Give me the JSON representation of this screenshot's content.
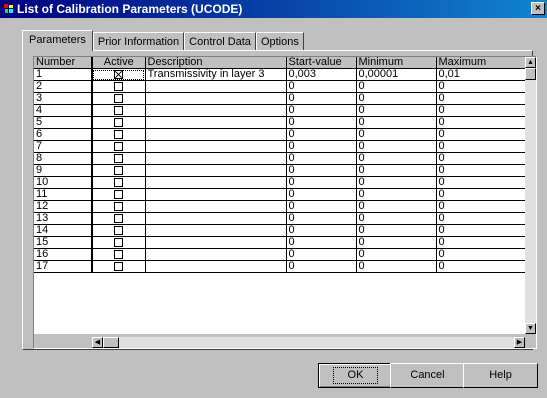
{
  "window": {
    "title": "List of Calibration Parameters (UCODE)",
    "close_label": "×"
  },
  "tabs": [
    "Parameters",
    "Prior Information",
    "Control Data",
    "Options"
  ],
  "active_tab": "Parameters",
  "table": {
    "columns": [
      "Number",
      "Active",
      "Description",
      "Start-value",
      "Minimum",
      "Maximum"
    ],
    "rows": [
      {
        "number": "1",
        "active": true,
        "description": "Transmissivity in layer 3",
        "start": "0,003",
        "min": "0,00001",
        "max": "0,01"
      },
      {
        "number": "2",
        "active": false,
        "description": "",
        "start": "0",
        "min": "0",
        "max": "0"
      },
      {
        "number": "3",
        "active": false,
        "description": "",
        "start": "0",
        "min": "0",
        "max": "0"
      },
      {
        "number": "4",
        "active": false,
        "description": "",
        "start": "0",
        "min": "0",
        "max": "0"
      },
      {
        "number": "5",
        "active": false,
        "description": "",
        "start": "0",
        "min": "0",
        "max": "0"
      },
      {
        "number": "6",
        "active": false,
        "description": "",
        "start": "0",
        "min": "0",
        "max": "0"
      },
      {
        "number": "7",
        "active": false,
        "description": "",
        "start": "0",
        "min": "0",
        "max": "0"
      },
      {
        "number": "8",
        "active": false,
        "description": "",
        "start": "0",
        "min": "0",
        "max": "0"
      },
      {
        "number": "9",
        "active": false,
        "description": "",
        "start": "0",
        "min": "0",
        "max": "0"
      },
      {
        "number": "10",
        "active": false,
        "description": "",
        "start": "0",
        "min": "0",
        "max": "0"
      },
      {
        "number": "11",
        "active": false,
        "description": "",
        "start": "0",
        "min": "0",
        "max": "0"
      },
      {
        "number": "12",
        "active": false,
        "description": "",
        "start": "0",
        "min": "0",
        "max": "0"
      },
      {
        "number": "13",
        "active": false,
        "description": "",
        "start": "0",
        "min": "0",
        "max": "0"
      },
      {
        "number": "14",
        "active": false,
        "description": "",
        "start": "0",
        "min": "0",
        "max": "0"
      },
      {
        "number": "15",
        "active": false,
        "description": "",
        "start": "0",
        "min": "0",
        "max": "0"
      },
      {
        "number": "16",
        "active": false,
        "description": "",
        "start": "0",
        "min": "0",
        "max": "0"
      },
      {
        "number": "17",
        "active": false,
        "description": "",
        "start": "0",
        "min": "0",
        "max": "0"
      }
    ]
  },
  "scrollbars": {
    "up_arrow": "▲",
    "down_arrow": "▼",
    "left_arrow": "◀",
    "right_arrow": "▶"
  },
  "buttons": {
    "ok": "OK",
    "cancel": "Cancel",
    "help": "Help"
  },
  "colors": {
    "titlebar": "#000080",
    "face": "#c0c0c0"
  },
  "icons": {
    "app": "ucode-app-icon"
  }
}
